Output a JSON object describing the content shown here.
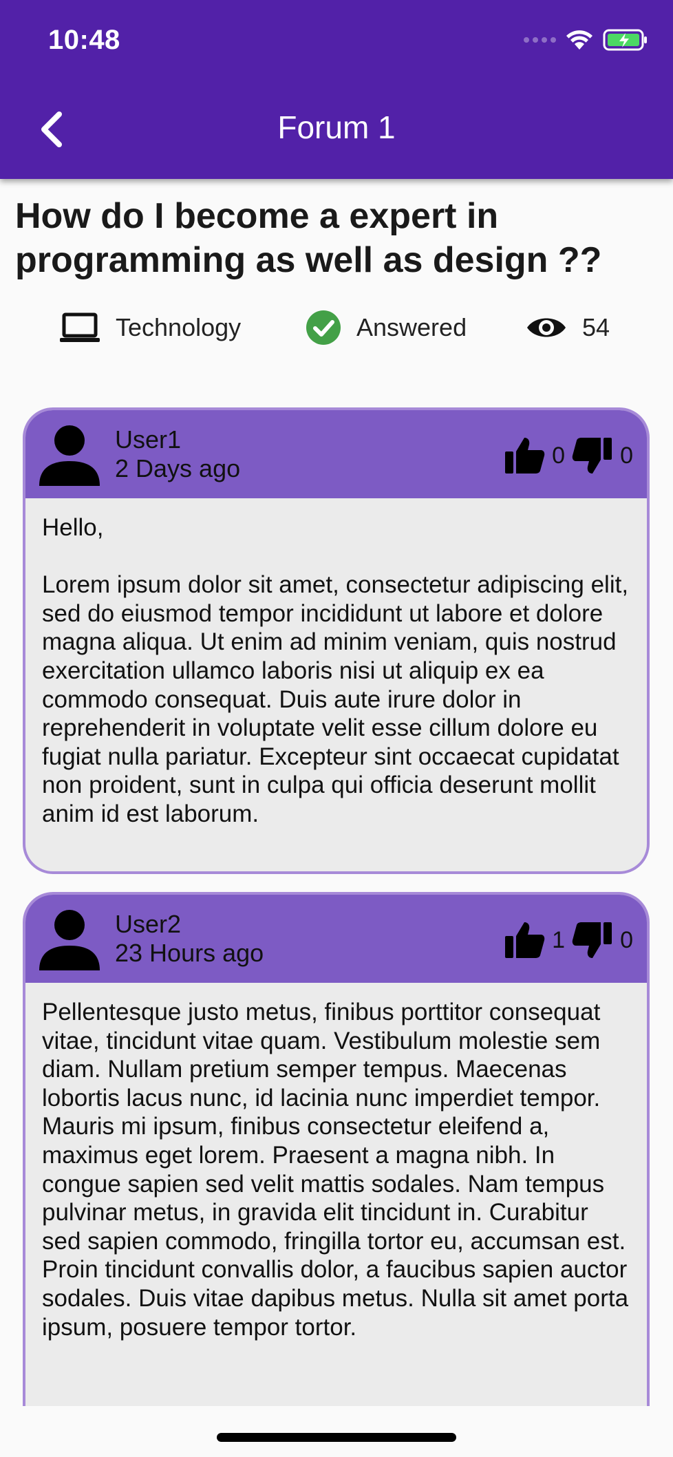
{
  "status_bar": {
    "time": "10:48"
  },
  "app_bar": {
    "title": "Forum 1"
  },
  "question": {
    "title": "How do I become a expert in programming as well as design ??",
    "category": "Technology",
    "status": "Answered",
    "views": "54"
  },
  "posts": [
    {
      "author": "User1",
      "time": "2 Days ago",
      "likes": "0",
      "dislikes": "0",
      "body": "Hello,\n\nLorem ipsum dolor sit amet, consectetur adipiscing elit, sed do eiusmod tempor incididunt ut labore et dolore magna aliqua. Ut enim ad minim veniam, quis nostrud exercitation ullamco laboris nisi ut aliquip ex ea commodo consequat. Duis aute irure dolor in reprehenderit in voluptate velit esse cillum dolore eu fugiat nulla pariatur. Excepteur sint occaecat cupidatat non proident, sunt in culpa qui officia deserunt mollit anim id est laborum."
    },
    {
      "author": "User2",
      "time": "23 Hours ago",
      "likes": "1",
      "dislikes": "0",
      "body": "Pellentesque justo metus, finibus porttitor consequat vitae, tincidunt vitae quam. Vestibulum molestie sem diam. Nullam pretium semper tempus. Maecenas lobortis lacus nunc, id lacinia nunc imperdiet tempor. Mauris mi ipsum, finibus consectetur eleifend a, maximus eget lorem. Praesent a magna nibh. In congue sapien sed velit mattis sodales. Nam tempus pulvinar metus, in gravida elit tincidunt in. Curabitur sed sapien commodo, fringilla tortor eu, accumsan est. Proin tincidunt convallis dolor, a faucibus sapien auctor sodales. Duis vitae dapibus metus. Nulla sit amet porta ipsum, posuere tempor tortor."
    }
  ],
  "icons": {
    "back": "chevron-left-icon",
    "category": "laptop-icon",
    "status": "check-circle-icon",
    "views": "eye-icon",
    "avatar": "person-icon",
    "like": "thumbs-up-icon",
    "dislike": "thumbs-down-icon"
  },
  "colors": {
    "app_bar": "#5221a8",
    "post_header": "#7d5bc4",
    "post_border": "#a78ad8",
    "post_body": "#ebebeb",
    "answered_green": "#43a047",
    "battery_green": "#4cd964"
  }
}
